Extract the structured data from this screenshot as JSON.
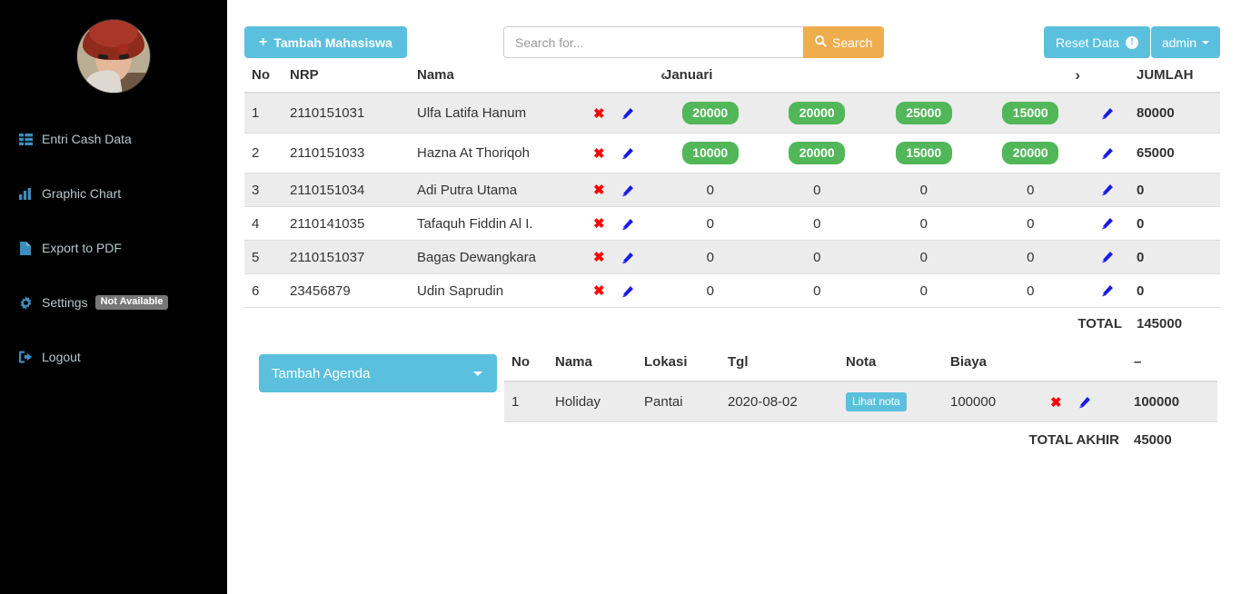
{
  "sidebar": {
    "avatar_name": "user-avatar",
    "items": [
      {
        "label": "Entri Cash Data",
        "icon": "th-list-icon"
      },
      {
        "label": "Graphic Chart",
        "icon": "bar-chart-icon"
      },
      {
        "label": "Export to PDF",
        "icon": "file-icon"
      },
      {
        "label": "Settings",
        "icon": "gear-icon",
        "badge": "Not Available"
      },
      {
        "label": "Logout",
        "icon": "logout-icon"
      }
    ]
  },
  "toolbar": {
    "add_label": "Tambah Mahasiswa",
    "add_plus": "+",
    "search_placeholder": "Search for...",
    "search_value": "",
    "search_label": "Search",
    "reset_label": "Reset Data",
    "reset_info": "!",
    "admin_label": "admin"
  },
  "main_table": {
    "headers": {
      "no": "No",
      "nrp": "NRP",
      "nama": "Nama",
      "month": "Januari",
      "prev": "‹",
      "next": "›",
      "jumlah": "JUMLAH"
    },
    "rows": [
      {
        "no": "1",
        "nrp": "2110151031",
        "nama": "Ulfa Latifa Hanum",
        "weeks": [
          "20000",
          "20000",
          "25000",
          "15000"
        ],
        "has_badges": true,
        "jumlah": "80000"
      },
      {
        "no": "2",
        "nrp": "2110151033",
        "nama": "Hazna At Thoriqoh",
        "weeks": [
          "10000",
          "20000",
          "15000",
          "20000"
        ],
        "has_badges": true,
        "jumlah": "65000"
      },
      {
        "no": "3",
        "nrp": "2110151034",
        "nama": "Adi Putra Utama",
        "weeks": [
          "0",
          "0",
          "0",
          "0"
        ],
        "has_badges": false,
        "jumlah": "0"
      },
      {
        "no": "4",
        "nrp": "2110141035",
        "nama": "Tafaquh Fiddin Al I.",
        "weeks": [
          "0",
          "0",
          "0",
          "0"
        ],
        "has_badges": false,
        "jumlah": "0"
      },
      {
        "no": "5",
        "nrp": "2110151037",
        "nama": "Bagas Dewangkara",
        "weeks": [
          "0",
          "0",
          "0",
          "0"
        ],
        "has_badges": false,
        "jumlah": "0"
      },
      {
        "no": "6",
        "nrp": "23456879",
        "nama": "Udin Saprudin",
        "weeks": [
          "0",
          "0",
          "0",
          "0"
        ],
        "has_badges": false,
        "jumlah": "0"
      }
    ],
    "total_label": "TOTAL",
    "total_value": "145000"
  },
  "agenda": {
    "button_label": "Tambah Agenda",
    "headers": {
      "no": "No",
      "nama": "Nama",
      "lokasi": "Lokasi",
      "tgl": "Tgl",
      "nota": "Nota",
      "biaya": "Biaya",
      "minus": "➖"
    },
    "minus_glyph": "–",
    "rows": [
      {
        "no": "1",
        "nama": "Holiday",
        "lokasi": "Pantai",
        "tgl": "2020-08-02",
        "nota": "Lihat nota",
        "biaya": "100000",
        "total": "100000"
      }
    ],
    "final_label": "TOTAL AKHIR",
    "final_value": "45000"
  },
  "icons": {
    "delete": "✖",
    "edit": "pencil-icon"
  },
  "colors": {
    "sidebar_bg": "#000000",
    "accent_info": "#5bc0de",
    "accent_warning": "#f0ad4e",
    "badge_success": "#51b759",
    "icon_blue": "#3c8dbc",
    "delete_red": "#ff0000",
    "edit_blue": "#1a1ae6",
    "stripe": "#ececec"
  }
}
